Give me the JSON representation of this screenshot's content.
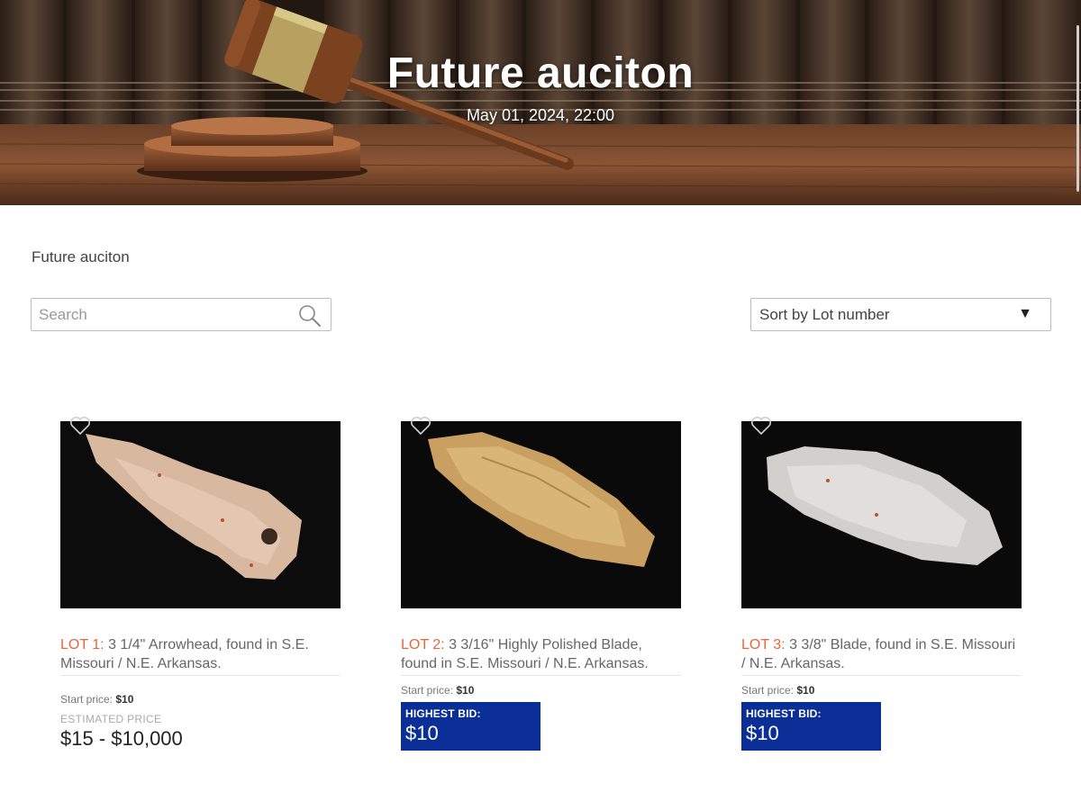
{
  "hero": {
    "title": "Future auciton",
    "date": "May 01, 2024, 22:00"
  },
  "breadcrumb": "Future auciton",
  "search": {
    "placeholder": "Search",
    "value": ""
  },
  "sort": {
    "selected": "Sort by Lot number"
  },
  "lots": [
    {
      "lot_label": "LOT 1:",
      "title": "3 1/4\" Arrowhead, found in S.E. Missouri / N.E. Arkansas.",
      "start_label": "Start price:",
      "start_value": "$10",
      "estimate_label": "ESTIMATED PRICE",
      "estimate_value": "$15 - $10,000"
    },
    {
      "lot_label": "LOT 2:",
      "title": "3 3/16\" Highly Polished Blade, found in S.E. Missouri / N.E. Arkansas.",
      "start_label": "Start price:",
      "start_value": "$10",
      "bid_label": "HIGHEST BID:",
      "bid_value": "$10"
    },
    {
      "lot_label": "LOT 3:",
      "title": "3 3/8\" Blade, found in S.E. Missouri / N.E. Arkansas.",
      "start_label": "Start price:",
      "start_value": "$10",
      "bid_label": "HIGHEST BID:",
      "bid_value": "$10"
    }
  ],
  "colors": {
    "lot_accent": "#e8663a",
    "bid_background": "#0b2f96"
  },
  "icons": {
    "search": "search-icon",
    "favorite": "heart-icon",
    "dropdown": "triangle-down-icon"
  }
}
